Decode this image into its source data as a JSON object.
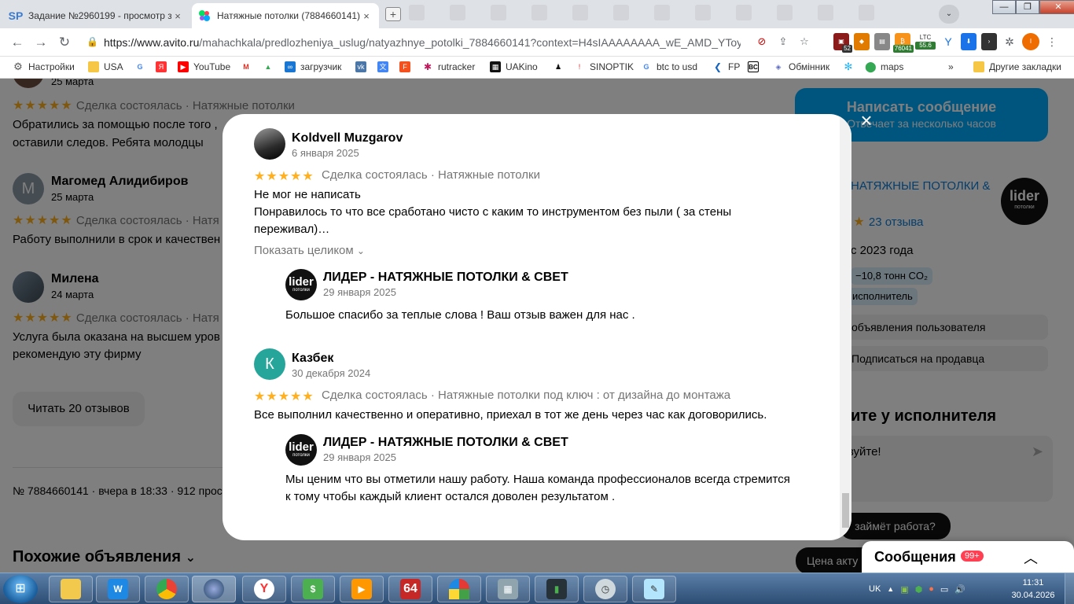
{
  "browser": {
    "tabs": [
      {
        "favicon": "SP",
        "title": "Задание №2960199 - просмотр з",
        "close": "×"
      },
      {
        "favicon": "avito-icon",
        "title": "Натяжные потолки (7884660141)",
        "close": "×"
      }
    ],
    "url_host": "https://www.avito.ru",
    "url_path": "/mahachkala/predlozheniya_uslug/natyazhnye_potolki_7884660141?context=H4sIAAAAAAAA_wE_AMD_YToy...",
    "extensions": {
      "badge_52": "52",
      "ltc_label": "LTC",
      "ltc_value_1": "76041",
      "ltc_value_2": "55.6"
    },
    "bookmarks": [
      "Настройки",
      "USA",
      "YouTube",
      "загрузчик",
      "rutracker",
      "UAKino",
      "SINOPTIK",
      "btc to usd",
      "FP",
      "Обмінник",
      "maps",
      "Другие закладки"
    ],
    "bookmarks_more": "»"
  },
  "background": {
    "review_top": {
      "date": "25 марта",
      "deal": "Сделка состоялась · Натяжные потолки",
      "text_line1": "Обратились за помощью после того ,",
      "text_line2": "оставили следов. Ребята молодцы"
    },
    "review_2": {
      "initial": "М",
      "name": "Магомед Алидибиров",
      "date": "25 марта",
      "deal": "Сделка состоялась · Натя",
      "text": "Работу выполнили в срок и качествен"
    },
    "review_3": {
      "name": "Милена",
      "date": "24 марта",
      "deal": "Сделка состоялась · Натя",
      "text_line1": "Услуга была оказана на высшем уров",
      "text_line2": "рекомендую эту фирму"
    },
    "read_button": "Читать 20 отзывов",
    "listing_meta": "№ 7884660141 · вчера в 18:33 · 912 просм",
    "similar": "Похожие объявления",
    "write_btn_title": "Написать сообщение",
    "write_btn_sub": "Отвечает за несколько часов",
    "seller_name": "НАТЯЖНЫЕ ПОТОЛКИ &",
    "reviews_count": "23 отзыва",
    "since": "с 2023 года",
    "co2_chip": "−10,8 тонн CO₂",
    "verified_chip": "исполнитель",
    "all_ads": "объявления пользователя",
    "subscribe": "Подписаться на продавца",
    "ask_heading": "ите у исполнителя",
    "greeting": "твуйте!",
    "how_long": "займёт работа?",
    "price_pill": "Цена акту",
    "messages_label": "Сообщения",
    "messages_count": "99+",
    "logo_word": "lider",
    "logo_sub": "потолки"
  },
  "modal": {
    "close_glyph": "×",
    "reviews": [
      {
        "name": "Koldvell Muzgarov",
        "date": "6 января 2025",
        "stars": "★★★★★",
        "deal": "Сделка состоялась · Натяжные потолки",
        "text_line1": "Не мог не написать",
        "text_line2": "Понравилось то что все сработано чисто с каким то инструментом без пыли ( за стены",
        "text_line3": "переживал)…",
        "show_more": "Показать целиком",
        "reply": {
          "logo": "lider",
          "logo_sub": "потолки",
          "name": "ЛИДЕР - НАТЯЖНЫЕ ПОТОЛКИ & СВЕТ",
          "date": "29 января 2025",
          "text": "Большое спасибо за теплые слова ! Ваш отзыв важен для нас ."
        }
      },
      {
        "initial": "К",
        "name": "Казбек",
        "date": "30 декабря 2024",
        "stars": "★★★★★",
        "deal": "Сделка состоялась · Натяжные потолки под ключ : от дизайна до монтажа",
        "text": "Все выполнил качественно и оперативно, приехал в тот же день через час как договорились.",
        "reply": {
          "logo": "lider",
          "logo_sub": "потолки",
          "name": "ЛИДЕР - НАТЯЖНЫЕ ПОТОЛКИ & СВЕТ",
          "date": "29 января 2025",
          "text_line1": "Мы ценим что вы отметили нашу работу. Наша команда профессионалов всегда стремится",
          "text_line2": "к тому чтобы каждый клиент остался доволен результатом ."
        }
      }
    ]
  },
  "taskbar": {
    "lang": "UK",
    "time": "11:31",
    "date": "30.04.2026",
    "app_64": "64"
  },
  "colors": {
    "avito_blue": "#00aaff",
    "star": "#ffb021",
    "kazbek_avatar": "#26a69a",
    "magomed_avatar": "#8a9aa6"
  }
}
